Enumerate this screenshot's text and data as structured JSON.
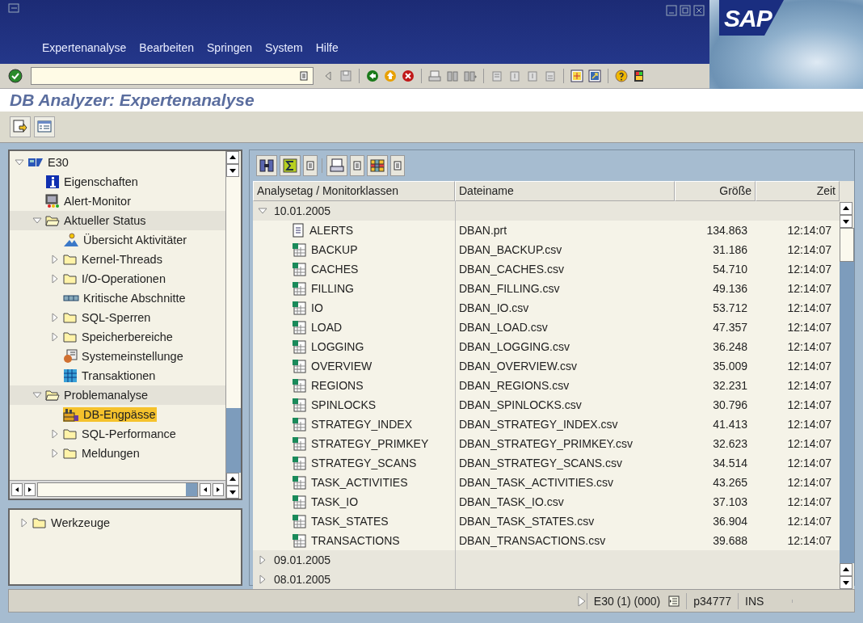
{
  "menu": [
    "Expertenanalyse",
    "Bearbeiten",
    "Springen",
    "System",
    "Hilfe"
  ],
  "logo": "SAP",
  "title": "DB Analyzer: Expertenanalyse",
  "tree": [
    {
      "label": "E30",
      "kind": "system",
      "expanded": true,
      "selected": false,
      "children": [
        {
          "label": "Eigenschaften",
          "kind": "info",
          "selected": false
        },
        {
          "label": "Alert-Monitor",
          "kind": "monitor",
          "selected": false
        },
        {
          "label": "Aktueller Status",
          "kind": "folder",
          "expanded": true,
          "selected": false,
          "children": [
            {
              "label": "Übersicht Aktivitäter",
              "kind": "person",
              "selected": false
            },
            {
              "label": "Kernel-Threads",
              "kind": "folder",
              "expanded": false,
              "selected": false
            },
            {
              "label": "I/O-Operationen",
              "kind": "folder",
              "expanded": false,
              "selected": false
            },
            {
              "label": "Kritische Abschnitte",
              "kind": "blocks",
              "selected": false
            },
            {
              "label": "SQL-Sperren",
              "kind": "folder",
              "expanded": false,
              "selected": false
            },
            {
              "label": "Speicherbereiche",
              "kind": "folder",
              "expanded": false,
              "selected": false
            },
            {
              "label": "Systemeinstellunge",
              "kind": "settings",
              "selected": false
            },
            {
              "label": "Transaktionen",
              "kind": "grid",
              "selected": false
            }
          ]
        },
        {
          "label": "Problemanalyse",
          "kind": "folder",
          "expanded": true,
          "selected": false,
          "children": [
            {
              "label": "DB-Engpässe",
              "kind": "factory",
              "selected": true
            },
            {
              "label": "SQL-Performance",
              "kind": "folder",
              "expanded": false,
              "selected": false
            },
            {
              "label": "Meldungen",
              "kind": "folder",
              "expanded": false,
              "selected": false
            }
          ]
        }
      ]
    }
  ],
  "tools_tree": [
    {
      "label": "Werkzeuge",
      "kind": "folder",
      "expanded": false,
      "selected": false
    }
  ],
  "table": {
    "columns": [
      "Analysetag / Monitorklassen",
      "Dateiname",
      "Größe",
      "Zeit"
    ],
    "groups": [
      {
        "date": "10.01.2005",
        "expanded": true,
        "rows": [
          {
            "name": "ALERTS",
            "kind": "text",
            "file": "DBAN.prt",
            "size": "134.863",
            "time": "12:14:07"
          },
          {
            "name": "BACKUP",
            "kind": "sheet",
            "file": "DBAN_BACKUP.csv",
            "size": "31.186",
            "time": "12:14:07"
          },
          {
            "name": "CACHES",
            "kind": "sheet",
            "file": "DBAN_CACHES.csv",
            "size": "54.710",
            "time": "12:14:07"
          },
          {
            "name": "FILLING",
            "kind": "sheet",
            "file": "DBAN_FILLING.csv",
            "size": "49.136",
            "time": "12:14:07"
          },
          {
            "name": "IO",
            "kind": "sheet",
            "file": "DBAN_IO.csv",
            "size": "53.712",
            "time": "12:14:07"
          },
          {
            "name": "LOAD",
            "kind": "sheet",
            "file": "DBAN_LOAD.csv",
            "size": "47.357",
            "time": "12:14:07"
          },
          {
            "name": "LOGGING",
            "kind": "sheet",
            "file": "DBAN_LOGGING.csv",
            "size": "36.248",
            "time": "12:14:07"
          },
          {
            "name": "OVERVIEW",
            "kind": "sheet",
            "file": "DBAN_OVERVIEW.csv",
            "size": "35.009",
            "time": "12:14:07"
          },
          {
            "name": "REGIONS",
            "kind": "sheet",
            "file": "DBAN_REGIONS.csv",
            "size": "32.231",
            "time": "12:14:07"
          },
          {
            "name": "SPINLOCKS",
            "kind": "sheet",
            "file": "DBAN_SPINLOCKS.csv",
            "size": "30.796",
            "time": "12:14:07"
          },
          {
            "name": "STRATEGY_INDEX",
            "kind": "sheet",
            "file": "DBAN_STRATEGY_INDEX.csv",
            "size": "41.413",
            "time": "12:14:07"
          },
          {
            "name": "STRATEGY_PRIMKEY",
            "kind": "sheet",
            "file": "DBAN_STRATEGY_PRIMKEY.csv",
            "size": "32.623",
            "time": "12:14:07"
          },
          {
            "name": "STRATEGY_SCANS",
            "kind": "sheet",
            "file": "DBAN_STRATEGY_SCANS.csv",
            "size": "34.514",
            "time": "12:14:07"
          },
          {
            "name": "TASK_ACTIVITIES",
            "kind": "sheet",
            "file": "DBAN_TASK_ACTIVITIES.csv",
            "size": "43.265",
            "time": "12:14:07"
          },
          {
            "name": "TASK_IO",
            "kind": "sheet",
            "file": "DBAN_TASK_IO.csv",
            "size": "37.103",
            "time": "12:14:07"
          },
          {
            "name": "TASK_STATES",
            "kind": "sheet",
            "file": "DBAN_TASK_STATES.csv",
            "size": "36.904",
            "time": "12:14:07"
          },
          {
            "name": "TRANSACTIONS",
            "kind": "sheet",
            "file": "DBAN_TRANSACTIONS.csv",
            "size": "39.688",
            "time": "12:14:07"
          }
        ]
      },
      {
        "date": "09.01.2005",
        "expanded": false
      },
      {
        "date": "08.01.2005",
        "expanded": false
      }
    ]
  },
  "status_bar": {
    "system": "E30 (1) (000)",
    "server": "p34777",
    "mode": "INS"
  }
}
